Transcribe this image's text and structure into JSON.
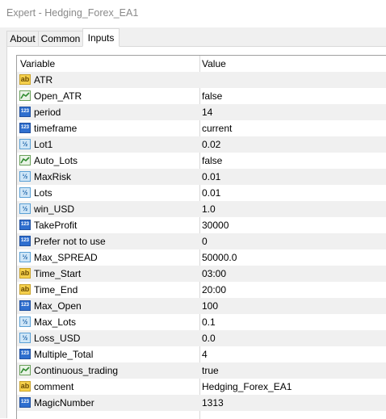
{
  "window": {
    "title": "Expert - Hedging_Forex_EA1"
  },
  "tabs": [
    {
      "label": "About"
    },
    {
      "label": "Common"
    },
    {
      "label": "Inputs"
    }
  ],
  "table": {
    "headers": {
      "variable": "Variable",
      "value": "Value"
    },
    "rows": [
      {
        "icon": "ab-string-icon",
        "name": "ATR",
        "value": ""
      },
      {
        "icon": "bool-icon",
        "name": "Open_ATR",
        "value": "false"
      },
      {
        "icon": "int-123-icon",
        "name": "period",
        "value": "14"
      },
      {
        "icon": "int-123-icon",
        "name": "timeframe",
        "value": "current"
      },
      {
        "icon": "double-icon",
        "name": "Lot1",
        "value": "0.02"
      },
      {
        "icon": "bool-icon",
        "name": "Auto_Lots",
        "value": "false"
      },
      {
        "icon": "double-icon",
        "name": "MaxRisk",
        "value": "0.01"
      },
      {
        "icon": "double-icon",
        "name": "Lots",
        "value": "0.01"
      },
      {
        "icon": "double-icon",
        "name": "win_USD",
        "value": "1.0"
      },
      {
        "icon": "int-123-icon",
        "name": "TakeProfit",
        "value": "30000"
      },
      {
        "icon": "int-123-icon",
        "name": "Prefer not to use",
        "value": "0"
      },
      {
        "icon": "double-icon",
        "name": "Max_SPREAD",
        "value": "50000.0"
      },
      {
        "icon": "ab-string-icon",
        "name": "Time_Start",
        "value": "03:00"
      },
      {
        "icon": "ab-string-icon",
        "name": "Time_End",
        "value": "20:00"
      },
      {
        "icon": "int-123-icon",
        "name": "Max_Open",
        "value": "100"
      },
      {
        "icon": "double-icon",
        "name": "Max_Lots",
        "value": "0.1"
      },
      {
        "icon": "double-icon",
        "name": "Loss_USD",
        "value": "0.0"
      },
      {
        "icon": "int-123-icon",
        "name": "Multiple_Total",
        "value": "4"
      },
      {
        "icon": "bool-icon",
        "name": "Continuous_trading",
        "value": "true"
      },
      {
        "icon": "ab-string-icon",
        "name": "comment",
        "value": "Hedging_Forex_EA1"
      },
      {
        "icon": "int-123-icon",
        "name": "MagicNumber",
        "value": "1313"
      }
    ]
  },
  "icon_glyphs": {
    "ab": "ab",
    "int": "123",
    "double": "½"
  },
  "colors": {
    "alt_row": "#f0f0f0",
    "grid_border": "#a0a0a0",
    "title_text": "#8a8a8a"
  }
}
